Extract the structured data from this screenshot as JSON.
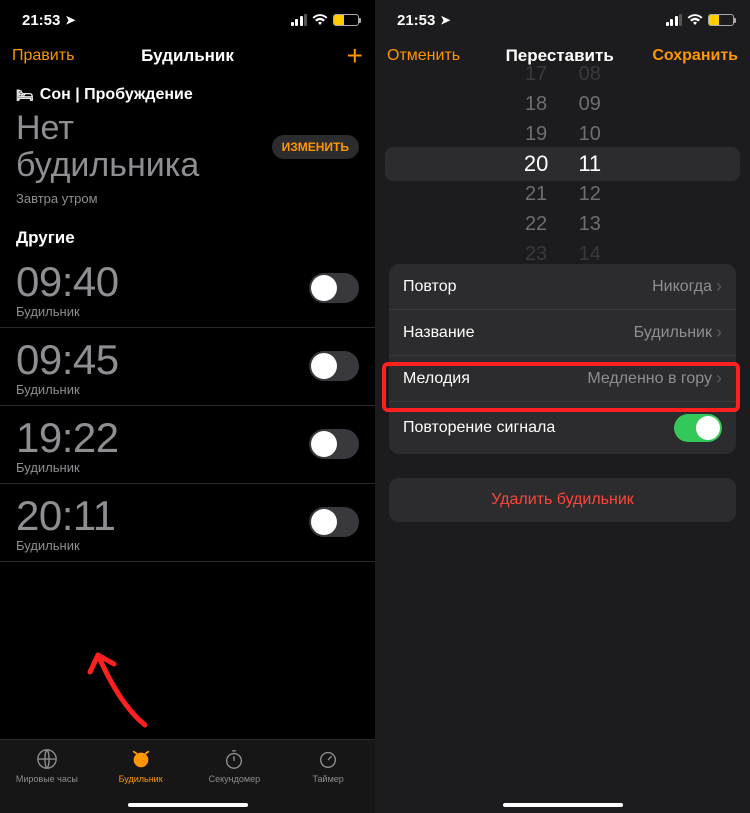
{
  "status": {
    "time": "21:53",
    "location_icon": "➤"
  },
  "left": {
    "nav": {
      "edit": "Править",
      "title": "Будильник",
      "add": "+"
    },
    "sleep": {
      "header_icon": "🛏",
      "header": "Сон | Пробуждение",
      "no_alarm_line1": "Нет",
      "no_alarm_line2": "будильника",
      "change": "ИЗМЕНИТЬ",
      "tomorrow": "Завтра утром"
    },
    "others_header": "Другие",
    "alarms": [
      {
        "time": "09:40",
        "label": "Будильник",
        "on": false
      },
      {
        "time": "09:45",
        "label": "Будильник",
        "on": false
      },
      {
        "time": "19:22",
        "label": "Будильник",
        "on": false
      },
      {
        "time": "20:11",
        "label": "Будильник",
        "on": false
      }
    ],
    "tabs": [
      {
        "label": "Мировые часы"
      },
      {
        "label": "Будильник"
      },
      {
        "label": "Секундомер"
      },
      {
        "label": "Таймер"
      }
    ]
  },
  "right": {
    "nav": {
      "cancel": "Отменить",
      "title": "Переставить",
      "save": "Сохранить"
    },
    "picker": {
      "hours": [
        "17",
        "18",
        "19",
        "20",
        "21",
        "22",
        "23"
      ],
      "minutes": [
        "08",
        "09",
        "10",
        "11",
        "12",
        "13",
        "14"
      ],
      "selected_hour": "20",
      "selected_minute": "11"
    },
    "settings": {
      "repeat_label": "Повтор",
      "repeat_value": "Никогда",
      "name_label": "Название",
      "name_value": "Будильник",
      "sound_label": "Мелодия",
      "sound_value": "Медленно в гору",
      "snooze_label": "Повторение сигнала",
      "snooze_on": true
    },
    "delete": "Удалить будильник"
  }
}
